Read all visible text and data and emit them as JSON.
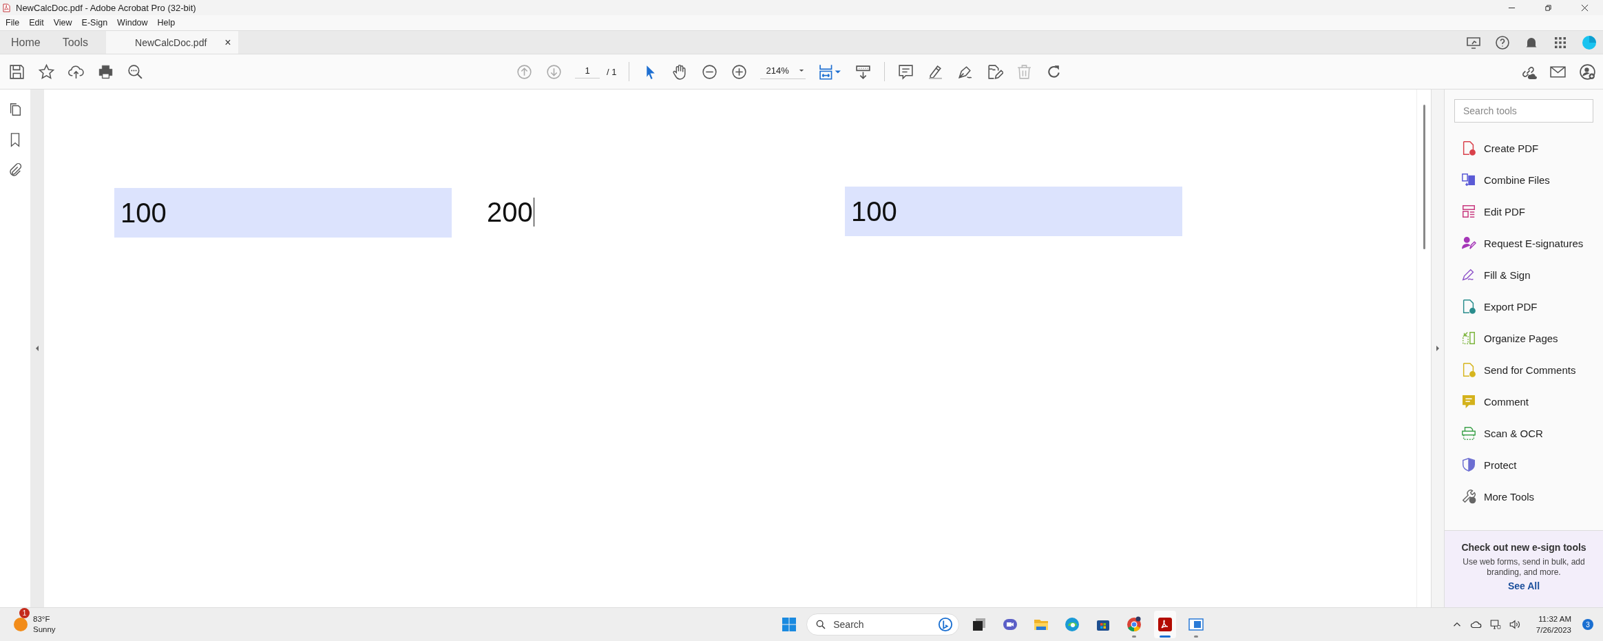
{
  "window": {
    "title": "NewCalcDoc.pdf - Adobe Acrobat Pro (32-bit)"
  },
  "menu": [
    "File",
    "Edit",
    "View",
    "E-Sign",
    "Window",
    "Help"
  ],
  "tabs": [
    {
      "label": "Home",
      "selected": false
    },
    {
      "label": "Tools",
      "selected": false
    },
    {
      "label": "NewCalcDoc.pdf",
      "selected": true,
      "close": "×"
    }
  ],
  "toolbar": {
    "page": "1",
    "page_count": "/ 1",
    "zoom": "214%"
  },
  "fields": [
    {
      "value": "100",
      "highlighted": true,
      "focused": false
    },
    {
      "value": "200",
      "highlighted": false,
      "focused": true
    },
    {
      "value": "100",
      "highlighted": true,
      "focused": false
    }
  ],
  "tools_panel": {
    "search": {
      "placeholder": "Search tools"
    },
    "tools": [
      {
        "label": "Create PDF",
        "kind": "document",
        "color": "#d9414b"
      },
      {
        "label": "Combine Files",
        "kind": "combine",
        "color": "#5b5bd6"
      },
      {
        "label": "Edit PDF",
        "kind": "layout",
        "color": "#c8387e"
      },
      {
        "label": "Request E-signatures",
        "kind": "person",
        "color": "#a537b8"
      },
      {
        "label": "Fill & Sign",
        "kind": "pen",
        "color": "#8f56c9"
      },
      {
        "label": "Export PDF",
        "kind": "document",
        "color": "#2a8d8d"
      },
      {
        "label": "Organize Pages",
        "kind": "pages",
        "color": "#7db53e"
      },
      {
        "label": "Send for Comments",
        "kind": "document",
        "color": "#d6b51e"
      },
      {
        "label": "Comment",
        "kind": "bubble",
        "color": "#d4b21c"
      },
      {
        "label": "Scan & OCR",
        "kind": "scanner",
        "color": "#3fa34d"
      },
      {
        "label": "Protect",
        "kind": "shield",
        "color": "#6c6ed2"
      },
      {
        "label": "More Tools",
        "kind": "wrench",
        "color": "#666666"
      }
    ],
    "promo": {
      "title": "Check out new e-sign tools",
      "text": "Use web forms, send in bulk, add branding, and more.",
      "link": "See All"
    }
  },
  "taskbar": {
    "weather": {
      "badge": "1",
      "temperature": "83°F",
      "condition": "Sunny"
    },
    "search": {
      "placeholder": "Search"
    },
    "apps": [
      {
        "kind": "taskview",
        "running": false,
        "active": false
      },
      {
        "kind": "meet",
        "running": false,
        "active": false
      },
      {
        "kind": "folder",
        "running": false,
        "active": false
      },
      {
        "kind": "browser",
        "running": false,
        "active": false
      },
      {
        "kind": "store",
        "running": false,
        "active": false
      },
      {
        "kind": "chrome",
        "running": true,
        "active": false
      },
      {
        "kind": "acrobat",
        "running": true,
        "active": true
      },
      {
        "kind": "window",
        "running": true,
        "active": false
      }
    ],
    "time": "11:32 AM",
    "date": "7/26/2023",
    "notifications": "3"
  }
}
